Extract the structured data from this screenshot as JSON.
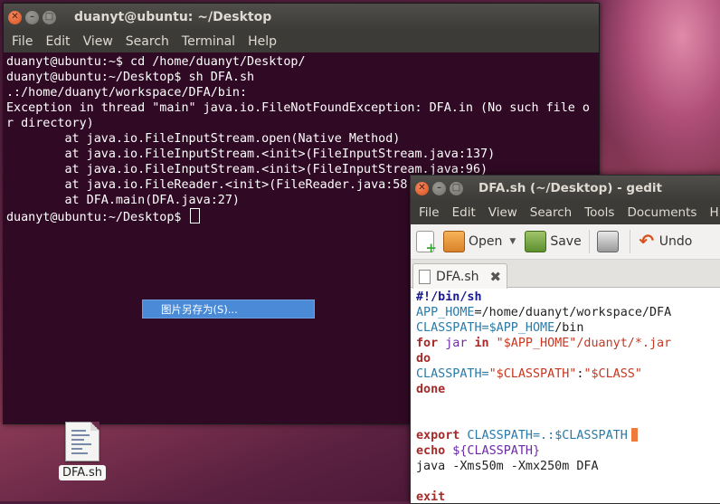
{
  "terminal": {
    "title": "duanyt@ubuntu: ~/Desktop",
    "menu": [
      "File",
      "Edit",
      "View",
      "Search",
      "Terminal",
      "Help"
    ],
    "lines": [
      "duanyt@ubuntu:~$ cd /home/duanyt/Desktop/",
      "duanyt@ubuntu:~/Desktop$ sh DFA.sh",
      ".:/home/duanyt/workspace/DFA/bin:",
      "Exception in thread \"main\" java.io.FileNotFoundException: DFA.in (No such file o",
      "r directory)",
      "        at java.io.FileInputStream.open(Native Method)",
      "        at java.io.FileInputStream.<init>(FileInputStream.java:137)",
      "        at java.io.FileInputStream.<init>(FileInputStream.java:96)",
      "        at java.io.FileReader.<init>(FileReader.java:58)",
      "        at DFA.main(DFA.java:27)"
    ],
    "prompt": "duanyt@ubuntu:~/Desktop$ "
  },
  "context_menu": {
    "item": "图片另存为(S)..."
  },
  "desktop_file": {
    "label": "DFA.sh"
  },
  "gedit": {
    "title": "DFA.sh (~/Desktop) - gedit",
    "menu": [
      "File",
      "Edit",
      "View",
      "Search",
      "Tools",
      "Documents",
      "H"
    ],
    "toolbar": {
      "open": "Open",
      "save": "Save",
      "undo": "Undo"
    },
    "tab": {
      "label": "DFA.sh"
    },
    "code": {
      "l1": "#!/bin/sh",
      "l2a": "APP_HOME",
      "l2b": "=/home/duanyt/workspace/DFA",
      "l3a": "CLASSPATH=",
      "l3b": "$APP_HOME",
      "l3c": "/bin",
      "l4a": "for",
      "l4b": " jar ",
      "l4c": "in",
      "l4d": " \"$APP_HOME\"/duanyt/*.jar",
      "l5": "do",
      "l6a": "CLASSPATH=",
      "l6b": "\"$CLASSPATH\"",
      "l6c": ":",
      "l6d": "\"$CLASS\"",
      "l7": "done",
      "l8a": "export",
      "l8b": " CLASSPATH=.:",
      "l8c": "$CLASSPATH",
      "l9a": "echo",
      "l9b": " ${CLASSPATH}",
      "l10": "java -Xms50m -Xmx250m DFA",
      "l11": "exit"
    }
  }
}
